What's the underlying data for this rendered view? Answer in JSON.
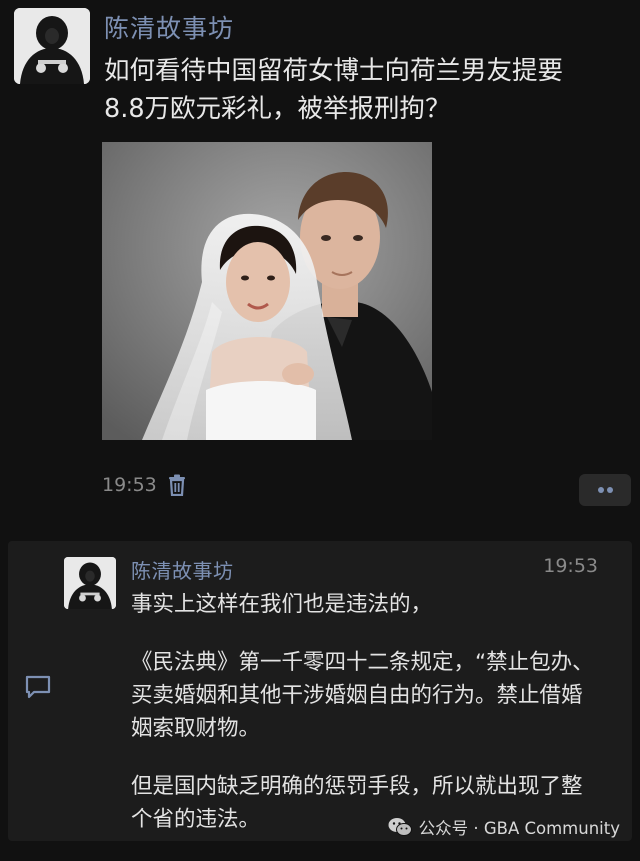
{
  "post": {
    "author": "陈清故事坊",
    "text_lines": [
      "如何看待中国留荷女博士向荷兰男友提要",
      "8.8万欧元彩礼，被举报刑拘？"
    ],
    "time": "19:53",
    "delete_icon": "trash-icon",
    "more_icon": "two-dots-icon"
  },
  "comment": {
    "author": "陈清故事坊",
    "time": "19:53",
    "paragraphs": [
      "事实上这样在我们也是违法的，",
      "《民法典》第一千零四十二条规定，“禁止包办、买卖婚姻和其他干涉婚姻自由的行为。禁止借婚姻索取财物。",
      "但是国内缺乏明确的惩罚手段，所以就出现了整个省的违法。"
    ],
    "side_icon": "comment-bubble-icon"
  },
  "watermark": {
    "text": "公众号 · GBA Community",
    "icon": "wechat-logo-icon"
  },
  "colors": {
    "background": "#111111",
    "panel": "#1c1c1c",
    "name_link": "#7d90b3",
    "text": "#e8e8e8",
    "meta": "#8a8a8a"
  }
}
